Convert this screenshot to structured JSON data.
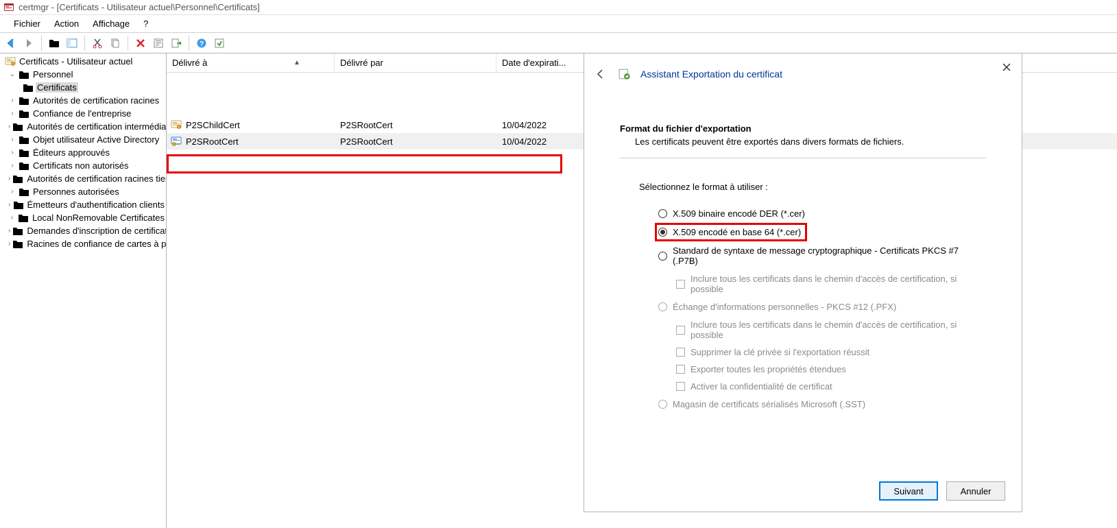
{
  "title_bar": {
    "text": "certmgr - [Certificats - Utilisateur actuel\\Personnel\\Certificats]"
  },
  "menu": {
    "file": "Fichier",
    "action": "Action",
    "view": "Affichage",
    "help": "?"
  },
  "toolbar_icons": {
    "back": "back-arrow",
    "forward": "forward-arrow",
    "up": "up-folder",
    "show_tree": "show-tree",
    "cut": "cut",
    "copy": "copy",
    "delete": "delete",
    "props": "properties",
    "export": "export",
    "help": "help",
    "refresh": "refresh"
  },
  "tree": {
    "root": "Certificats - Utilisateur actuel",
    "nodes": [
      {
        "label": "Personnel",
        "children": [
          {
            "label": "Certificats",
            "selected": true
          }
        ]
      },
      {
        "label": "Autorités de certification racines"
      },
      {
        "label": "Confiance de l'entreprise"
      },
      {
        "label": "Autorités de certification intermédiaires"
      },
      {
        "label": "Objet utilisateur Active Directory"
      },
      {
        "label": "Éditeurs approuvés"
      },
      {
        "label": "Certificats non autorisés"
      },
      {
        "label": "Autorités de certification racines tierces"
      },
      {
        "label": "Personnes autorisées"
      },
      {
        "label": "Émetteurs d'authentification clients"
      },
      {
        "label": "Local NonRemovable Certificates"
      },
      {
        "label": "Demandes d'inscription de certificat"
      },
      {
        "label": "Racines de confiance de cartes à puce"
      }
    ]
  },
  "list": {
    "columns": {
      "c1": "Délivré à",
      "c2": "Délivré par",
      "c3": "Date d'expirati..."
    },
    "rows": [
      {
        "name": "P2SChildCert",
        "issuer": "P2SRootCert",
        "expires": "10/04/2022",
        "icon": "cert"
      },
      {
        "name": "P2SRootCert",
        "issuer": "P2SRootCert",
        "expires": "10/04/2022",
        "icon": "cert-key",
        "selected": true,
        "highlighted": true
      }
    ]
  },
  "wizard": {
    "title": "Assistant Exportation du certificat",
    "section_title": "Format du fichier d'exportation",
    "section_sub": "Les certificats peuvent être exportés dans divers formats de fichiers.",
    "prompt": "Sélectionnez le format à utiliser :",
    "options": {
      "der": "X.509 binaire encodé DER (*.cer)",
      "b64": "X.509 encodé en base 64 (*.cer)",
      "p7b": "Standard de syntaxe de message cryptographique - Certificats PKCS #7 (.P7B)",
      "p7b_chain": "Inclure tous les certificats dans le chemin d'accès de certification, si possible",
      "pfx": "Échange d'informations personnelles - PKCS #12 (.PFX)",
      "pfx_chain": "Inclure tous les certificats dans le chemin d'accès de certification, si possible",
      "pfx_delkey": "Supprimer la clé privée si l'exportation réussit",
      "pfx_ext": "Exporter toutes les propriétés étendues",
      "pfx_privacy": "Activer la confidentialité de certificat",
      "sst": "Magasin de certificats sérialisés Microsoft (.SST)"
    },
    "selected_option": "b64",
    "buttons": {
      "next": "Suivant",
      "cancel": "Annuler"
    }
  }
}
